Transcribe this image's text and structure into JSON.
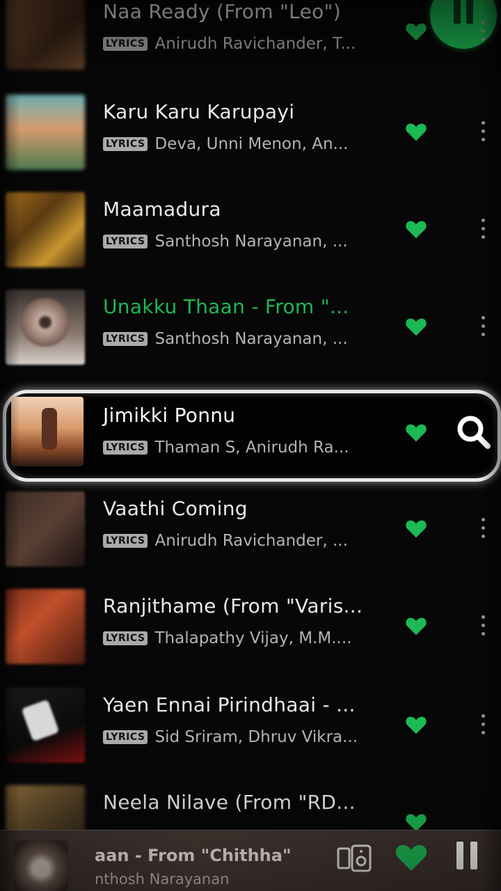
{
  "badge_label": "LYRICS",
  "tracks": [
    {
      "title": "Naa Ready (From \"Leo\")",
      "artist": "Anirudh Ravichander, T...",
      "liked": true
    },
    {
      "title": "Karu Karu Karupayi",
      "artist": "Deva, Unni Menon, An...",
      "liked": true
    },
    {
      "title": "Maamadura",
      "artist": "Santhosh Narayanan, ...",
      "liked": true
    },
    {
      "title": "Unakku Thaan - From \"...",
      "artist": "Santhosh Narayanan, ...",
      "liked": true,
      "playing": true
    },
    {
      "title": "Jimikki Ponnu",
      "artist": "Thaman S, Anirudh Ra...",
      "liked": true,
      "highlighted": true
    },
    {
      "title": "Vaathi Coming",
      "artist": "Anirudh Ravichander, ...",
      "liked": true
    },
    {
      "title": "Ranjithame (From \"Varis...",
      "artist": "Thalapathy Vijay, M.M....",
      "liked": true
    },
    {
      "title": "Yaen Ennai Pirindhaai - ...",
      "artist": "Sid Sriram, Dhruv Vikra...",
      "liked": true
    },
    {
      "title": "Neela Nilave (From \"RD...",
      "artist": "",
      "liked": true
    }
  ],
  "now_playing": {
    "title": "aan - From \"Chithha\"",
    "artist": "nthosh Narayanan",
    "liked": true,
    "is_playing": true
  },
  "icons": {
    "heart": "heart-icon",
    "more": "more-options-icon",
    "search": "search-icon",
    "device": "connect-device-icon",
    "pause": "pause-icon"
  },
  "colors": {
    "accent": "#1db954",
    "background": "#070707",
    "player_bar": "#4a3b36",
    "highlight_border": "#e8e8e8"
  }
}
